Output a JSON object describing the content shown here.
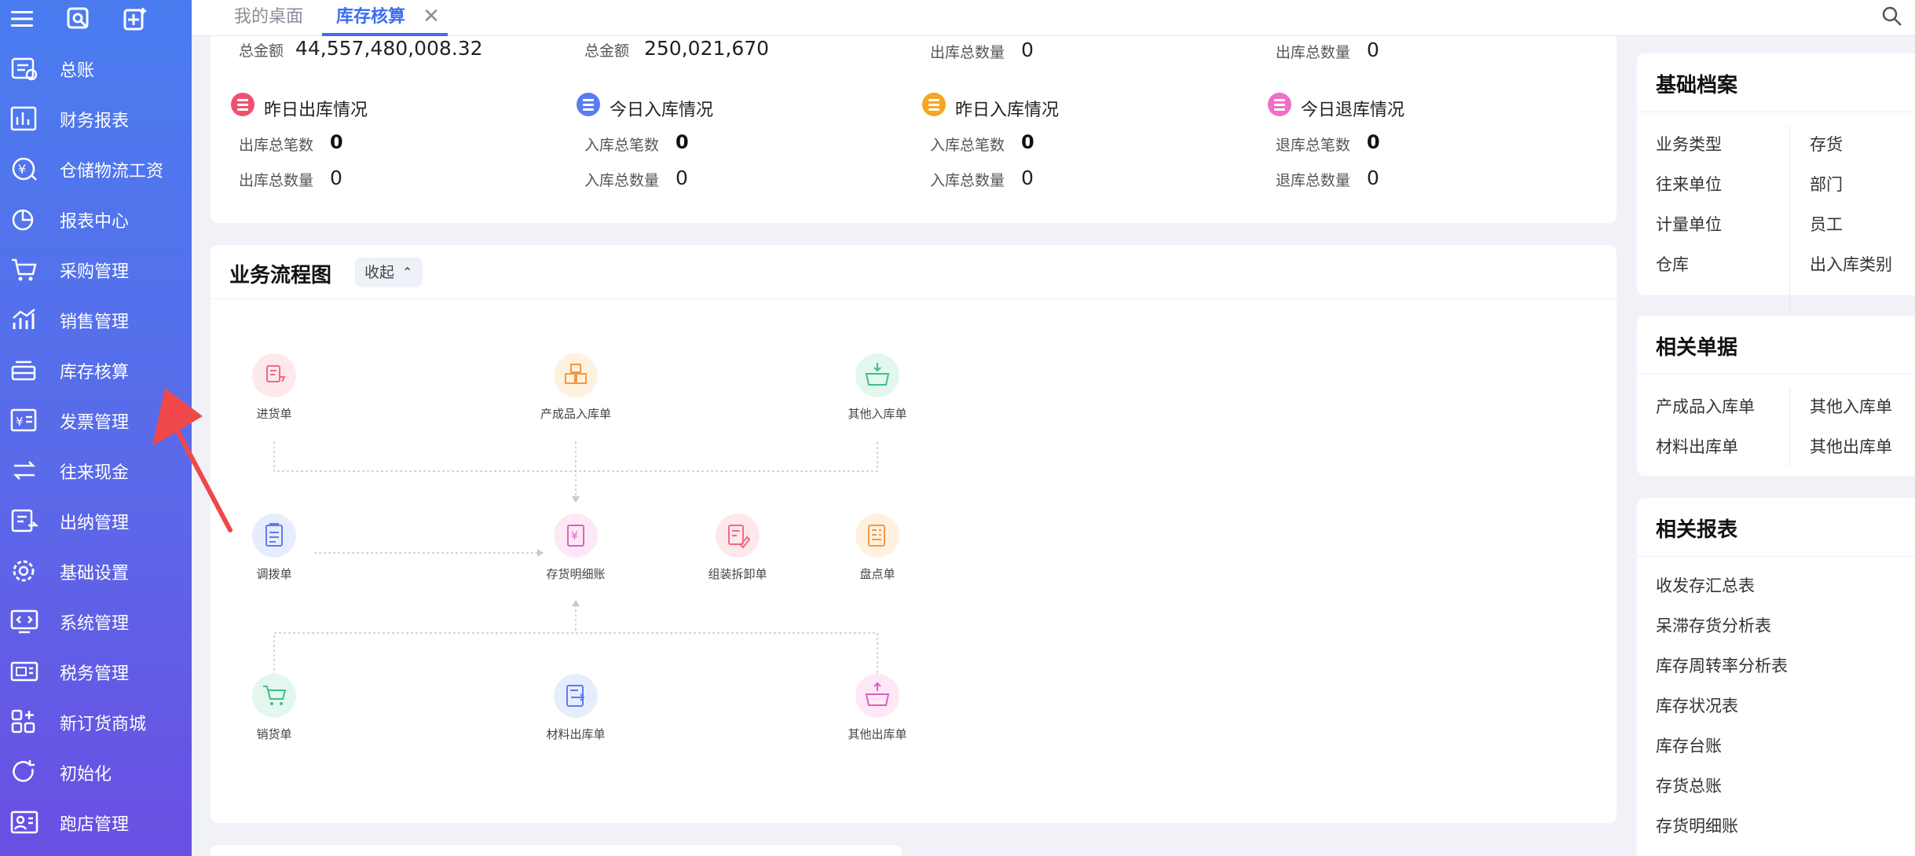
{
  "sidebar": {
    "items": [
      {
        "label": "总账",
        "icon": "ledger-icon"
      },
      {
        "label": "财务报表",
        "icon": "report-icon"
      },
      {
        "label": "仓储物流工资",
        "icon": "wage-icon"
      },
      {
        "label": "报表中心",
        "icon": "pie-chart-icon"
      },
      {
        "label": "采购管理",
        "icon": "cart-icon"
      },
      {
        "label": "销售管理",
        "icon": "sales-chart-icon"
      },
      {
        "label": "库存核算",
        "icon": "inventory-icon"
      },
      {
        "label": "发票管理",
        "icon": "invoice-icon"
      },
      {
        "label": "往来现金",
        "icon": "exchange-icon"
      },
      {
        "label": "出纳管理",
        "icon": "cashier-icon"
      },
      {
        "label": "基础设置",
        "icon": "settings-icon"
      },
      {
        "label": "系统管理",
        "icon": "system-icon"
      },
      {
        "label": "税务管理",
        "icon": "tax-icon"
      },
      {
        "label": "新订货商城",
        "icon": "mall-icon"
      },
      {
        "label": "初始化",
        "icon": "refresh-icon"
      },
      {
        "label": "跑店管理",
        "icon": "store-icon"
      }
    ]
  },
  "tabs": {
    "desk": "我的桌面",
    "active": "库存核算",
    "close": "✕"
  },
  "stats": {
    "top_row": [
      {
        "label": "总金额",
        "value": "44,557,480,008.32"
      },
      {
        "label": "总金额",
        "value": "250,021,670"
      },
      {
        "label": "出库总数量",
        "value": "0"
      },
      {
        "label": "出库总数量",
        "value": "0"
      }
    ],
    "cards": [
      {
        "title": "昨日出库情况",
        "color": "#f0506e",
        "count_label": "出库总笔数",
        "count": "0",
        "qty_label": "出库总数量",
        "qty": "0"
      },
      {
        "title": "今日入库情况",
        "color": "#5b7cf0",
        "count_label": "入库总笔数",
        "count": "0",
        "qty_label": "入库总数量",
        "qty": "0"
      },
      {
        "title": "昨日入库情况",
        "color": "#f5a623",
        "count_label": "入库总笔数",
        "count": "0",
        "qty_label": "入库总数量",
        "qty": "0"
      },
      {
        "title": "今日退库情况",
        "color": "#ef6fc8",
        "count_label": "退库总笔数",
        "count": "0",
        "qty_label": "退库总数量",
        "qty": "0"
      }
    ]
  },
  "flow": {
    "title": "业务流程图",
    "collapse": "收起",
    "collapse_icon": "chevron-up-icon",
    "nodes": [
      {
        "label": "进货单",
        "icon": "purchase-receipt-icon",
        "bg": "#fde8ec",
        "fg": "#ef6a82"
      },
      {
        "label": "产成品入库单",
        "icon": "boxes-icon",
        "bg": "#fff1df",
        "fg": "#f2994a"
      },
      {
        "label": "其他入库单",
        "icon": "basket-in-icon",
        "bg": "#e3f7ee",
        "fg": "#3cc08a"
      },
      {
        "label": "调拨单",
        "icon": "clipboard-icon",
        "bg": "#e8edfd",
        "fg": "#5b7cf0"
      },
      {
        "label": "存货明细账",
        "icon": "ledger-detail-icon",
        "bg": "#fde8f6",
        "fg": "#e05fc0"
      },
      {
        "label": "组装拆卸单",
        "icon": "assembly-icon",
        "bg": "#fde8ec",
        "fg": "#ef6a82"
      },
      {
        "label": "盘点单",
        "icon": "stocktake-icon",
        "bg": "#fff1df",
        "fg": "#f2994a"
      },
      {
        "label": "销货单",
        "icon": "sales-cart-icon",
        "bg": "#e3f7ee",
        "fg": "#3cc08a"
      },
      {
        "label": "材料出库单",
        "icon": "material-out-icon",
        "bg": "#e8edfd",
        "fg": "#5b7cf0"
      },
      {
        "label": "其他出库单",
        "icon": "basket-out-icon",
        "bg": "#fde8f6",
        "fg": "#e05fc0"
      }
    ]
  },
  "right": {
    "basic": {
      "title": "基础档案",
      "left": [
        "业务类型",
        "往来单位",
        "计量单位",
        "仓库"
      ],
      "right": [
        "存货",
        "部门",
        "员工",
        "出入库类别"
      ]
    },
    "docs": {
      "title": "相关单据",
      "left": [
        "产成品入库单",
        "材料出库单"
      ],
      "right": [
        "其他入库单",
        "其他出库单"
      ]
    },
    "reports": {
      "title": "相关报表",
      "items": [
        "收发存汇总表",
        "呆滞存货分析表",
        "库存周转率分析表",
        "库存状况表",
        "库存台账",
        "存货总账",
        "存货明细账"
      ]
    }
  }
}
